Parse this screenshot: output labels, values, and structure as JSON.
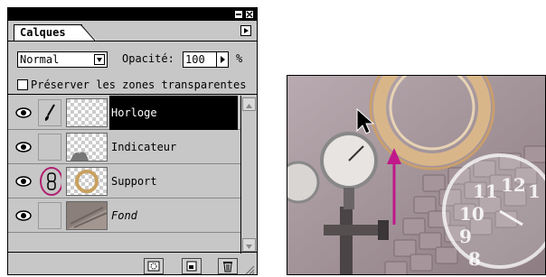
{
  "palette": {
    "tab_label": "Calques",
    "blend_mode": "Normal",
    "opacity_label": "Opacité:",
    "opacity_value": "100",
    "opacity_unit": "%",
    "preserve_label": "Préserver les zones transparentes",
    "layers": [
      {
        "name": "Horloge",
        "selected": true,
        "italic": false,
        "visible": true,
        "brush": true,
        "linked": false
      },
      {
        "name": "Indicateur",
        "selected": false,
        "italic": false,
        "visible": true,
        "brush": false,
        "linked": false
      },
      {
        "name": "Support",
        "selected": false,
        "italic": false,
        "visible": true,
        "brush": false,
        "linked": true
      },
      {
        "name": "Fond",
        "selected": false,
        "italic": true,
        "visible": true,
        "brush": false,
        "linked": false
      }
    ]
  },
  "photo": {
    "clock_numerals": [
      "11",
      "12",
      "1",
      "10",
      "9",
      "8"
    ]
  },
  "colors": {
    "highlight_circle": "#b0206f",
    "arrow": "#c0188a"
  }
}
